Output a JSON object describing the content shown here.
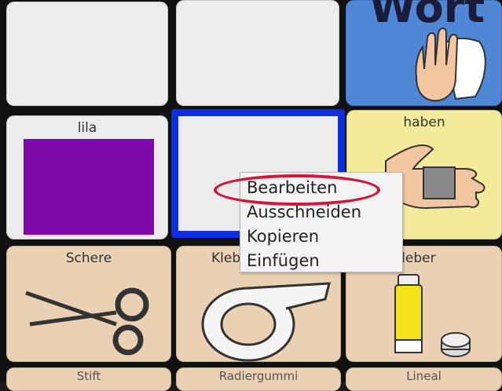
{
  "grid": {
    "cells": [
      {
        "label": ""
      },
      {
        "label": ""
      },
      {
        "label": "Wort",
        "color": "#4f86d6"
      },
      {
        "label": "lila",
        "color": "#ececec"
      },
      {
        "label": "haben",
        "color": "#f3ea9a"
      },
      {
        "label": "Schere",
        "color": "#ead1b3"
      },
      {
        "label": "Kleb",
        "color": "#ead1b3"
      },
      {
        "label": "Kleber",
        "color": "#ead1b3"
      }
    ],
    "bottom_row_labels": [
      "Stift",
      "Radiergummi",
      "Lineal"
    ],
    "selected_color": "#0d2fe0"
  },
  "context_menu": {
    "items": [
      {
        "label": "Bearbeiten"
      },
      {
        "label": "Ausschneiden"
      },
      {
        "label": "Kopieren"
      },
      {
        "label": "Einfügen"
      }
    ]
  },
  "highlight_color": "#d6133a",
  "swatch_color": "#7d0aa8"
}
